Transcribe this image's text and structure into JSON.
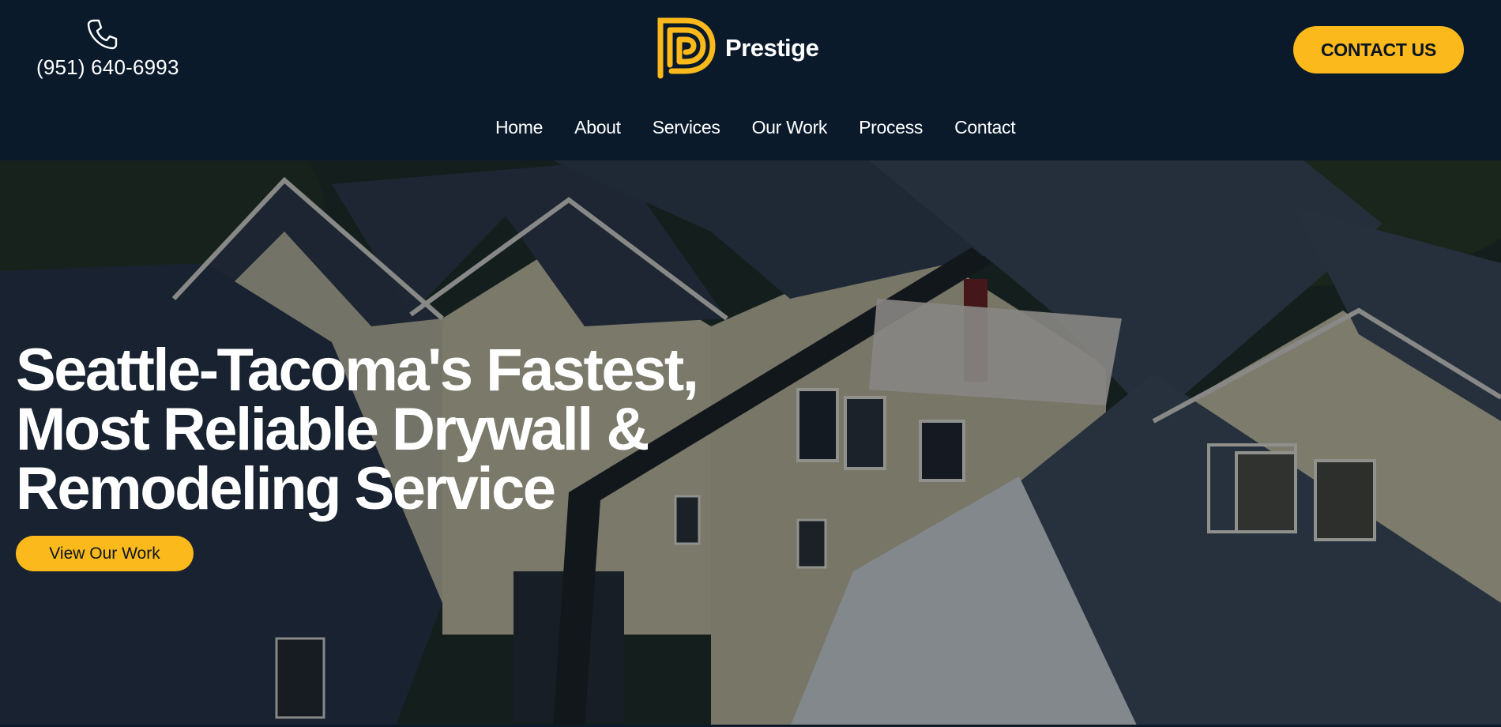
{
  "header": {
    "phone": {
      "icon": "phone-icon",
      "number": "(951) 640-6993"
    },
    "brand": {
      "logo_icon": "prestige-logo-icon",
      "name": "Prestige"
    },
    "contact_button_label": "CONTACT US"
  },
  "nav": {
    "items": [
      {
        "label": "Home"
      },
      {
        "label": "About"
      },
      {
        "label": "Services"
      },
      {
        "label": "Our Work"
      },
      {
        "label": "Process"
      },
      {
        "label": "Contact"
      }
    ]
  },
  "hero": {
    "title_lines": [
      "Seattle-Tacoma's Fastest,",
      "Most Reliable Drywall &",
      "Remodeling Service"
    ],
    "cta_label": "View Our Work",
    "background_image": "aerial view of new townhouses with crane lifting drywall"
  },
  "colors": {
    "header_bg": "#0a1a2b",
    "accent": "#fbb91b",
    "text_light": "#ffffff",
    "button_text": "#0b1422"
  }
}
